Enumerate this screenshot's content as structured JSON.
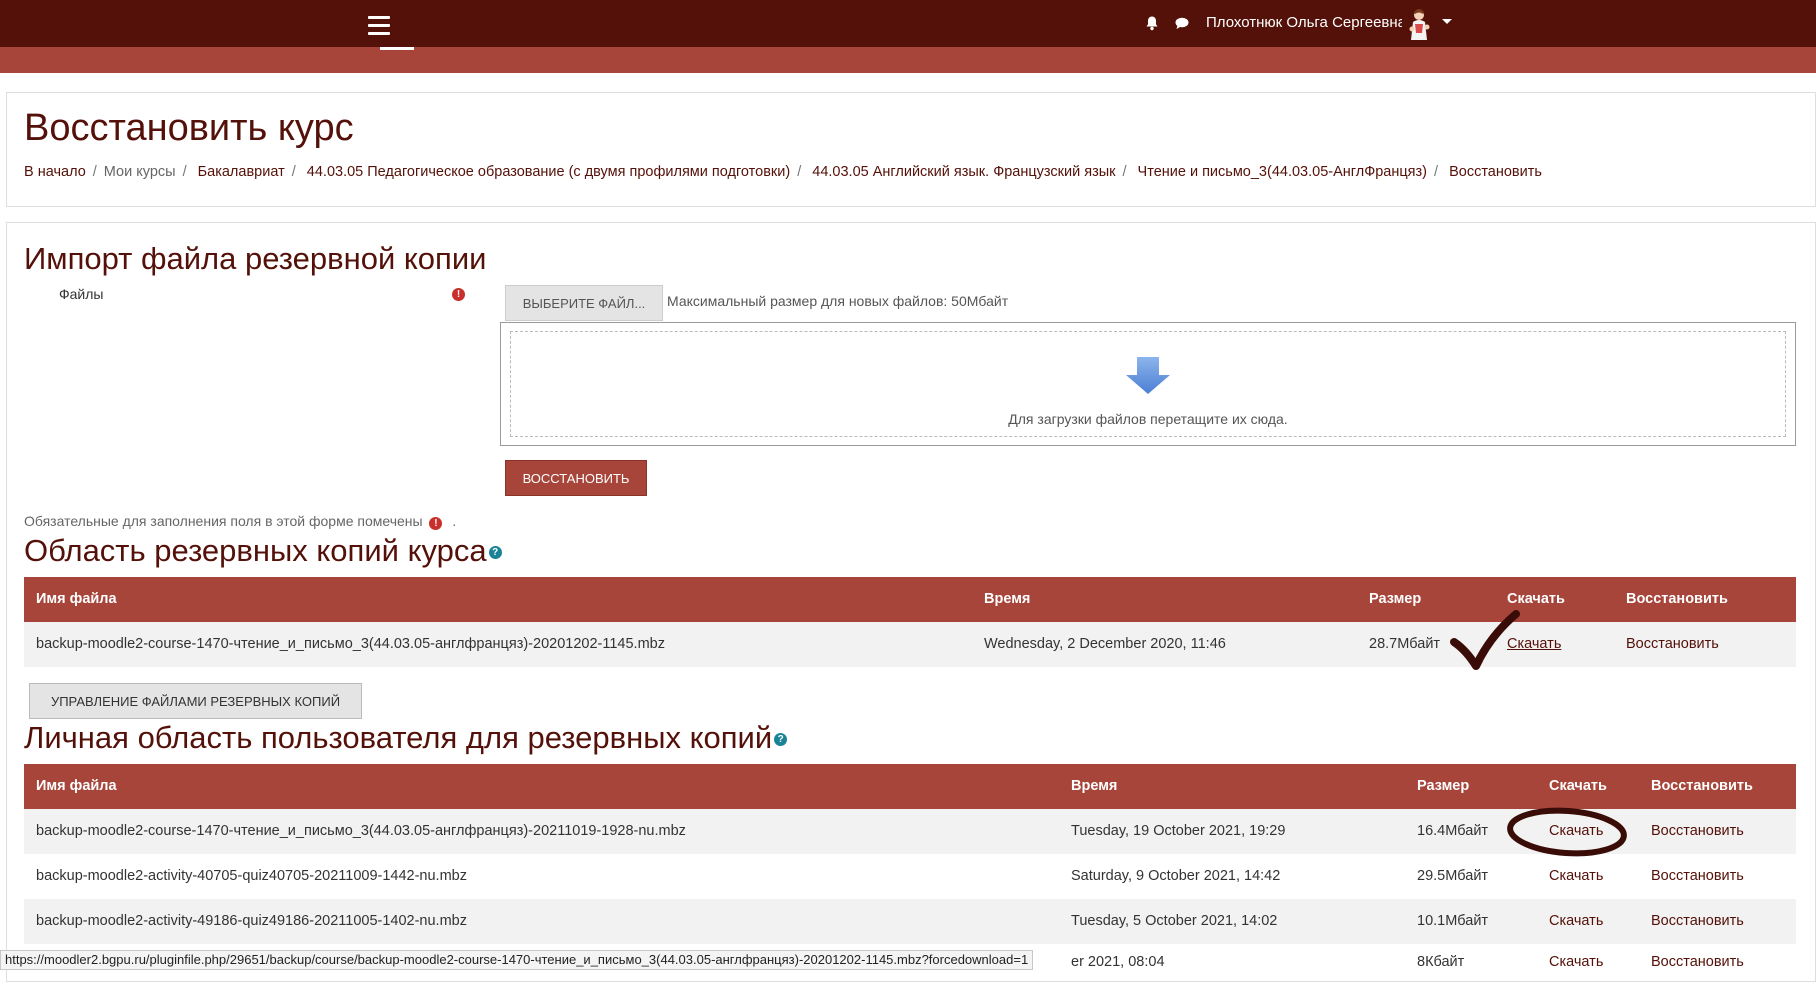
{
  "navbar": {
    "user_name": "Плохотнюк Ольга Сергеевна",
    "icons": [
      "hamburger-menu-icon",
      "bell-icon",
      "chat-icon",
      "avatar",
      "caret-down-icon"
    ]
  },
  "page": {
    "title": "Восстановить курс",
    "breadcrumb": [
      "В начало",
      "Мои курсы",
      "Бакалавриат",
      "44.03.05 Педагогическое образование (с двумя профилями подготовки)",
      "44.03.05 Английский язык. Французский язык",
      "Чтение и письмо_3(44.03.05-АнглФранцяз)",
      "Восстановить"
    ]
  },
  "import": {
    "title": "Импорт файла резервной копии",
    "files_label": "Файлы",
    "choose_button": "ВЫБЕРИТЕ ФАЙЛ...",
    "max_size": "Максимальный размер для новых файлов: 50Мбайт",
    "drop_text": "Для загрузки файлов перетащите их сюда.",
    "restore_button": "ВОССТАНОВИТЬ",
    "required_note": "Обязательные для заполнения поля в этой форме помечены",
    "required_note_end": "."
  },
  "course_area": {
    "title": "Область резервных копий курса",
    "headers": {
      "filename": "Имя файла",
      "time": "Время",
      "size": "Размер",
      "download": "Скачать",
      "restore": "Восстановить"
    },
    "rows": [
      {
        "filename": "backup-moodle2-course-1470-чтение_и_письмо_3(44.03.05-англфранцяз)-20201202-1145.mbz",
        "time": "Wednesday, 2 December 2020, 11:46",
        "size": "28.7Мбайт",
        "download": "Скачать",
        "restore": "Восстановить"
      }
    ],
    "manage_button": "УПРАВЛЕНИЕ ФАЙЛАМИ РЕЗЕРВНЫХ КОПИЙ"
  },
  "user_area": {
    "title": "Личная область пользователя для резервных копий",
    "headers": {
      "filename": "Имя файла",
      "time": "Время",
      "size": "Размер",
      "download": "Скачать",
      "restore": "Восстановить"
    },
    "rows": [
      {
        "filename": "backup-moodle2-course-1470-чтение_и_письмо_3(44.03.05-англфранцяз)-20211019-1928-nu.mbz",
        "time": "Tuesday, 19 October 2021, 19:29",
        "size": "16.4Мбайт",
        "download": "Скачать",
        "restore": "Восстановить"
      },
      {
        "filename": "backup-moodle2-activity-40705-quiz40705-20211009-1442-nu.mbz",
        "time": "Saturday, 9 October 2021, 14:42",
        "size": "29.5Мбайт",
        "download": "Скачать",
        "restore": "Восстановить"
      },
      {
        "filename": "backup-moodle2-activity-49186-quiz49186-20211005-1402-nu.mbz",
        "time": "Tuesday, 5 October 2021, 14:02",
        "size": "10.1Мбайт",
        "download": "Скачать",
        "restore": "Восстановить"
      },
      {
        "filename": "",
        "time": "er 2021, 08:04",
        "size": "8Кбайт",
        "download": "Скачать",
        "restore": "Восстановить"
      }
    ]
  },
  "status_bar": {
    "url": "https://moodler2.bgpu.ru/pluginfile.php/29651/backup/course/backup-moodle2-course-1470-чтение_и_письмо_3(44.03.05-англфранцяз)-20201202-1145.mbz?forcedownload=1"
  },
  "colors": {
    "navbar": "#541109",
    "accent": "#a8453a",
    "link": "#541109",
    "help": "#1b8397",
    "required": "#c9302c"
  }
}
